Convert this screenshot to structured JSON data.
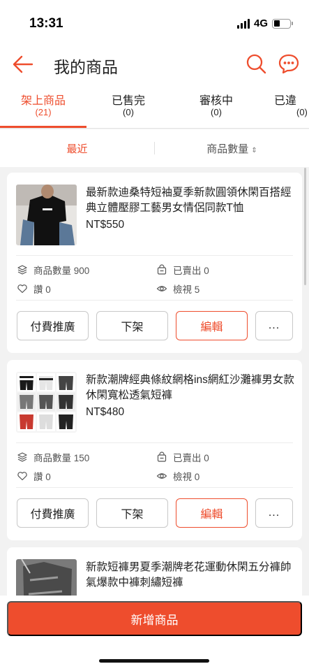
{
  "status": {
    "time": "13:31",
    "network": "4G"
  },
  "header": {
    "title": "我的商品",
    "back_icon": "arrow-left-icon",
    "search_icon": "search-icon",
    "chat_icon": "chat-icon",
    "accent": "#ee4d2d"
  },
  "tabs": [
    {
      "label": "架上商品",
      "count": "(21)",
      "active": true
    },
    {
      "label": "已售完",
      "count": "(0)",
      "active": false
    },
    {
      "label": "審核中",
      "count": "(0)",
      "active": false
    },
    {
      "label": "已違",
      "count": "(0)",
      "active": false
    }
  ],
  "sort": {
    "recent": "最近",
    "quantity": "商品數量",
    "quantity_arrows": "⇕"
  },
  "products": [
    {
      "title": "最新款迪桑特短袖夏季新款圓領休閑百搭經典立體壓膠工藝男女情侶同款T恤",
      "price": "NT$550",
      "qty_label": "商品數量",
      "qty": "900",
      "sold_label": "已賣出",
      "sold": "0",
      "likes_label": "讚",
      "likes": "0",
      "views_label": "檢視",
      "views": "5",
      "btn_promote": "付費推廣",
      "btn_delist": "下架",
      "btn_edit": "編輯",
      "btn_more": "..."
    },
    {
      "title": "新款潮牌經典條紋網格ins網紅沙灘褲男女款休閑寬松透氣短褲",
      "price": "NT$480",
      "qty_label": "商品數量",
      "qty": "150",
      "sold_label": "已賣出",
      "sold": "0",
      "likes_label": "讚",
      "likes": "0",
      "views_label": "檢視",
      "views": "0",
      "btn_promote": "付費推廣",
      "btn_delist": "下架",
      "btn_edit": "編輯",
      "btn_more": "..."
    },
    {
      "title": "新款短褲男夏季潮牌老花運動休閑五分褲帥氣爆款中褲刺繡短褲"
    }
  ],
  "footer": {
    "add_button": "新增商品"
  }
}
